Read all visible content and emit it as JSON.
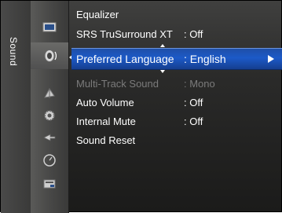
{
  "sidebar": {
    "title": "Sound"
  },
  "icons": [
    {
      "name": "picture-icon",
      "active": false
    },
    {
      "name": "speaker-icon",
      "active": true
    },
    {
      "name": "channel-icon",
      "active": false
    },
    {
      "name": "setup-icon",
      "active": false
    },
    {
      "name": "input-icon",
      "active": false
    },
    {
      "name": "application-icon",
      "active": false
    },
    {
      "name": "support-icon",
      "active": false
    }
  ],
  "menu": {
    "items": [
      {
        "label": "Equalizer",
        "value": ""
      },
      {
        "label": "SRS TruSurround XT",
        "value": ": Off"
      },
      {
        "label": "Preferred Language",
        "value": ": English"
      },
      {
        "label": "Multi-Track Sound",
        "value": ": Mono"
      },
      {
        "label": "Auto Volume",
        "value": ": Off"
      },
      {
        "label": "Internal Mute",
        "value": ": Off"
      },
      {
        "label": "Sound Reset",
        "value": ""
      }
    ]
  },
  "colors": {
    "selected": "#1c5ac8",
    "disabled": "#7b7b7b",
    "text": "#ffffff"
  }
}
